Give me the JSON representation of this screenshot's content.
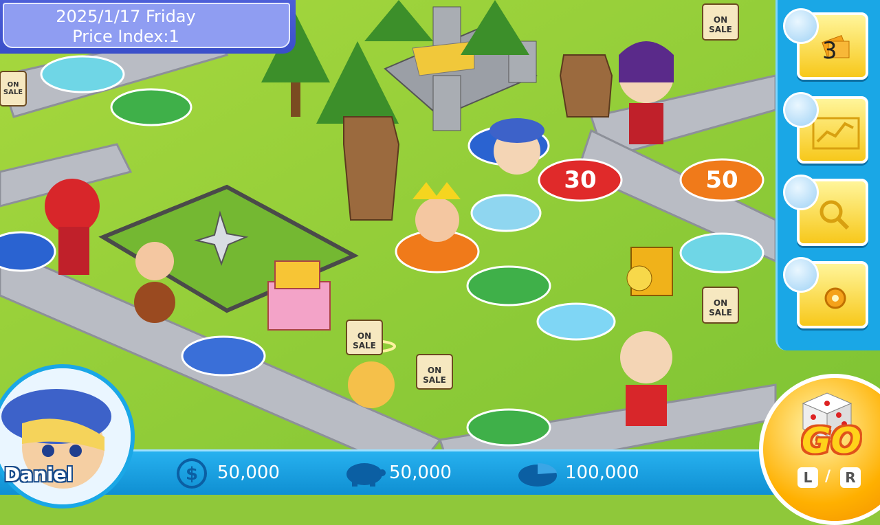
{
  "header": {
    "date": "2025/1/17  Friday",
    "price_index": "Price Index:1"
  },
  "sidebar": {
    "cards_count": "3",
    "buttons": [
      {
        "icon": "cards-icon"
      },
      {
        "icon": "stock-chart-icon"
      },
      {
        "icon": "magnifier-icon"
      },
      {
        "icon": "gear-icon"
      }
    ]
  },
  "board": {
    "tiles": [
      {
        "label": "30"
      },
      {
        "label": "50"
      },
      {
        "label": "ON SALE"
      },
      {
        "label": "ON SALE"
      },
      {
        "label": "ON SALE"
      },
      {
        "label": "ON SALE"
      },
      {
        "label": "ON SALE"
      }
    ]
  },
  "player": {
    "name": "Daniel",
    "cash": "50,000",
    "savings": "50,000",
    "total": "100,000"
  },
  "go_button": {
    "label": "GO",
    "left": "L",
    "separator": "/",
    "right": "R"
  }
}
